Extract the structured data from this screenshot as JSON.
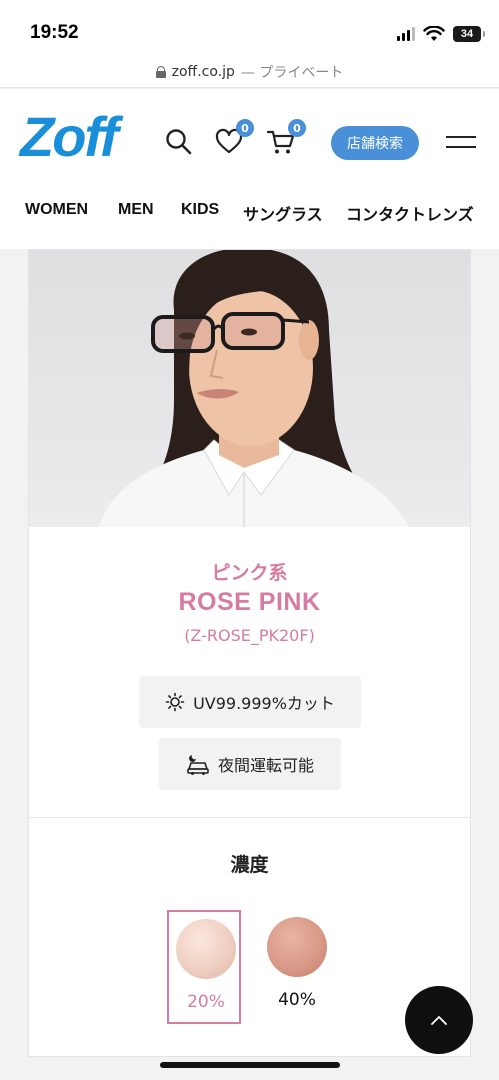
{
  "status_bar": {
    "time": "19:52",
    "battery": "34"
  },
  "browser": {
    "domain": "zoff.co.jp",
    "suffix": "— プライベート"
  },
  "header": {
    "logo": "Zoff",
    "favorites_count": "0",
    "cart_count": "0",
    "store_search_label": "店舗検索",
    "brand_color": "#1a8fd9",
    "accent_color": "#4a90d9"
  },
  "nav": {
    "items": [
      "WOMEN",
      "MEN",
      "KIDS",
      "サングラス",
      "コンタクトレンズ"
    ]
  },
  "product": {
    "color_group": "ピンク系",
    "color_name": "ROSE PINK",
    "color_code": "(Z-ROSE_PK20F)",
    "features": [
      {
        "icon": "sun-icon",
        "label": "UV99.999%カット"
      },
      {
        "icon": "night-drive-icon",
        "label": "夜間運転可能"
      }
    ],
    "accent_color": "#d67ca3"
  },
  "density": {
    "title": "濃度",
    "options": [
      {
        "label": "20%",
        "selected": true,
        "swatch_color": "#efcfc2"
      },
      {
        "label": "40%",
        "selected": false,
        "swatch_color": "#d99a88"
      }
    ]
  },
  "controls": {
    "scroll_top_icon": "chevron-up-icon"
  }
}
